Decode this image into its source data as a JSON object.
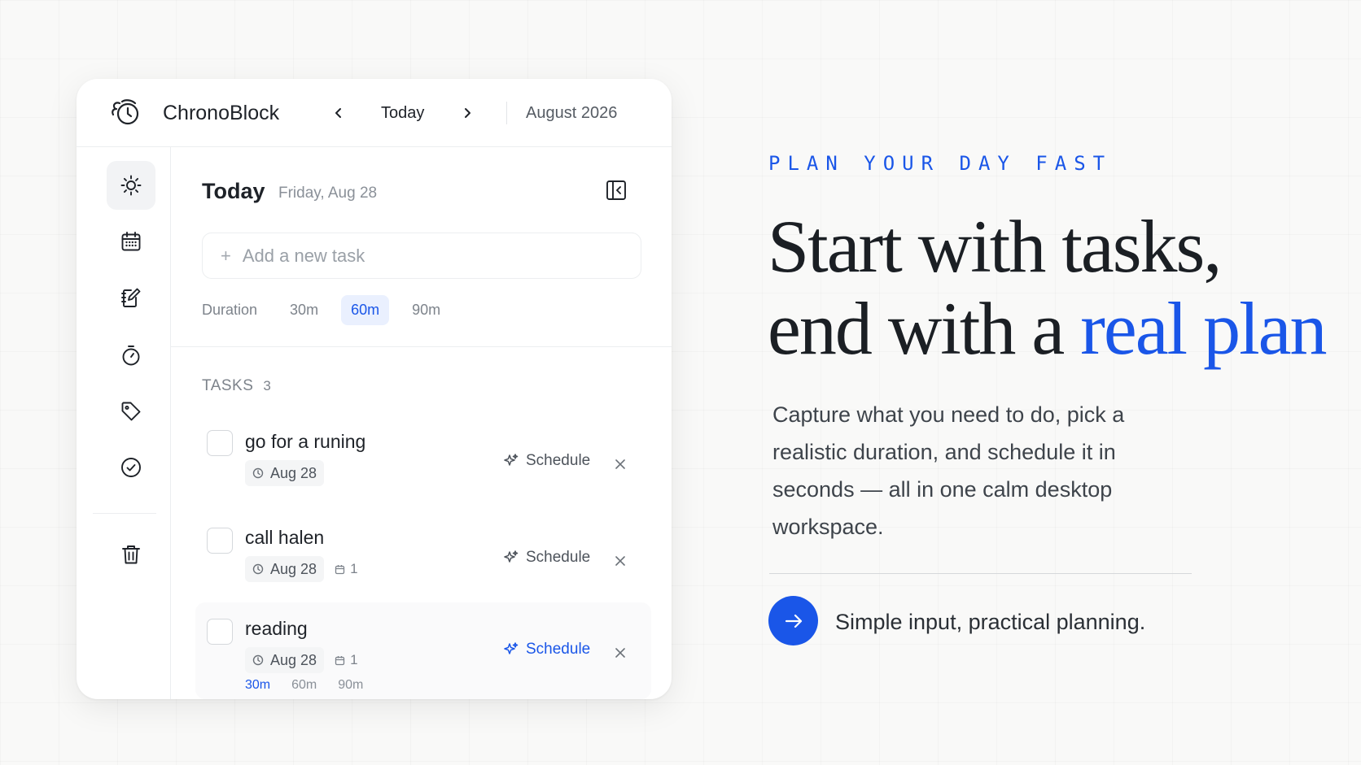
{
  "app": {
    "name": "ChronoBlock",
    "nav": {
      "today_label": "Today",
      "month_label": "August 2026"
    }
  },
  "sidebar": {
    "items": [
      {
        "name": "sun-icon",
        "active": true
      },
      {
        "name": "calendar-icon"
      },
      {
        "name": "notes-icon"
      },
      {
        "name": "timer-icon"
      },
      {
        "name": "tag-icon"
      },
      {
        "name": "check-circle-icon"
      },
      {
        "name": "trash-icon"
      }
    ]
  },
  "main": {
    "title": "Today",
    "date": "Friday, Aug 28",
    "add_task": {
      "placeholder": "Add a new task",
      "plus": "+"
    },
    "duration": {
      "label": "Duration",
      "options": [
        "30m",
        "60m",
        "90m"
      ],
      "selected": "60m"
    },
    "tasks_header": "TASKS",
    "tasks_count": "3",
    "schedule_label": "Schedule",
    "tasks": [
      {
        "title": "go for a runing",
        "date": "Aug 28",
        "blocks": ""
      },
      {
        "title": "call halen",
        "date": "Aug 28",
        "blocks": "1"
      },
      {
        "title": "reading",
        "date": "Aug 28",
        "blocks": "1",
        "durations": [
          "30m",
          "60m",
          "90m"
        ],
        "selected_duration": "30m"
      }
    ]
  },
  "marketing": {
    "eyebrow": "PLAN YOUR DAY FAST",
    "headline_line1": "Start with tasks,",
    "headline_line2_prefix": "end with a ",
    "headline_line2_accent": "real plan",
    "body": "Capture what you need to do, pick a realistic duration, and schedule it in seconds — all in one calm desktop workspace.",
    "cta_text": "Simple input, practical planning."
  },
  "colors": {
    "accent": "#1a56e8",
    "background": "#f9f9f8",
    "text": "#1b1f24"
  }
}
